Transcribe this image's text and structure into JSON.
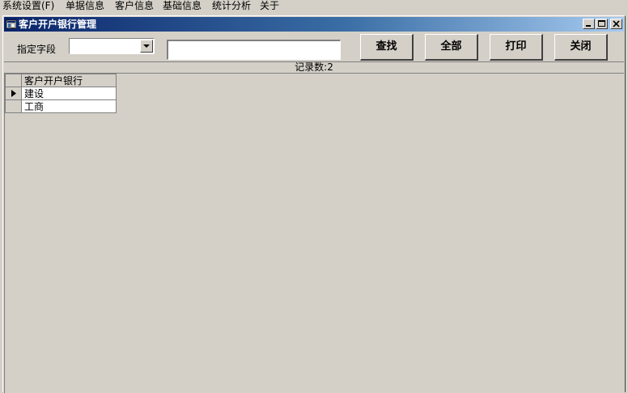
{
  "menubar": {
    "items": [
      {
        "label": "系统设置(F)"
      },
      {
        "label": "单据信息"
      },
      {
        "label": "客户信息"
      },
      {
        "label": "基础信息"
      },
      {
        "label": "统计分析"
      },
      {
        "label": "关于"
      }
    ]
  },
  "window": {
    "title": "客户开户银行管理",
    "controls": {
      "minimize": "_",
      "maximize": "□",
      "close": "×"
    }
  },
  "toolbar": {
    "field_label": "指定字段",
    "field_select_value": "",
    "search_value": "",
    "buttons": {
      "search": "查找",
      "all": "全部",
      "print": "打印",
      "close": "关闭"
    }
  },
  "records": {
    "label": "记录数:2"
  },
  "grid": {
    "columns": [
      "客户开户银行"
    ],
    "rows": [
      {
        "bank": "建设",
        "current": true
      },
      {
        "bank": "工商",
        "current": false
      }
    ]
  }
}
